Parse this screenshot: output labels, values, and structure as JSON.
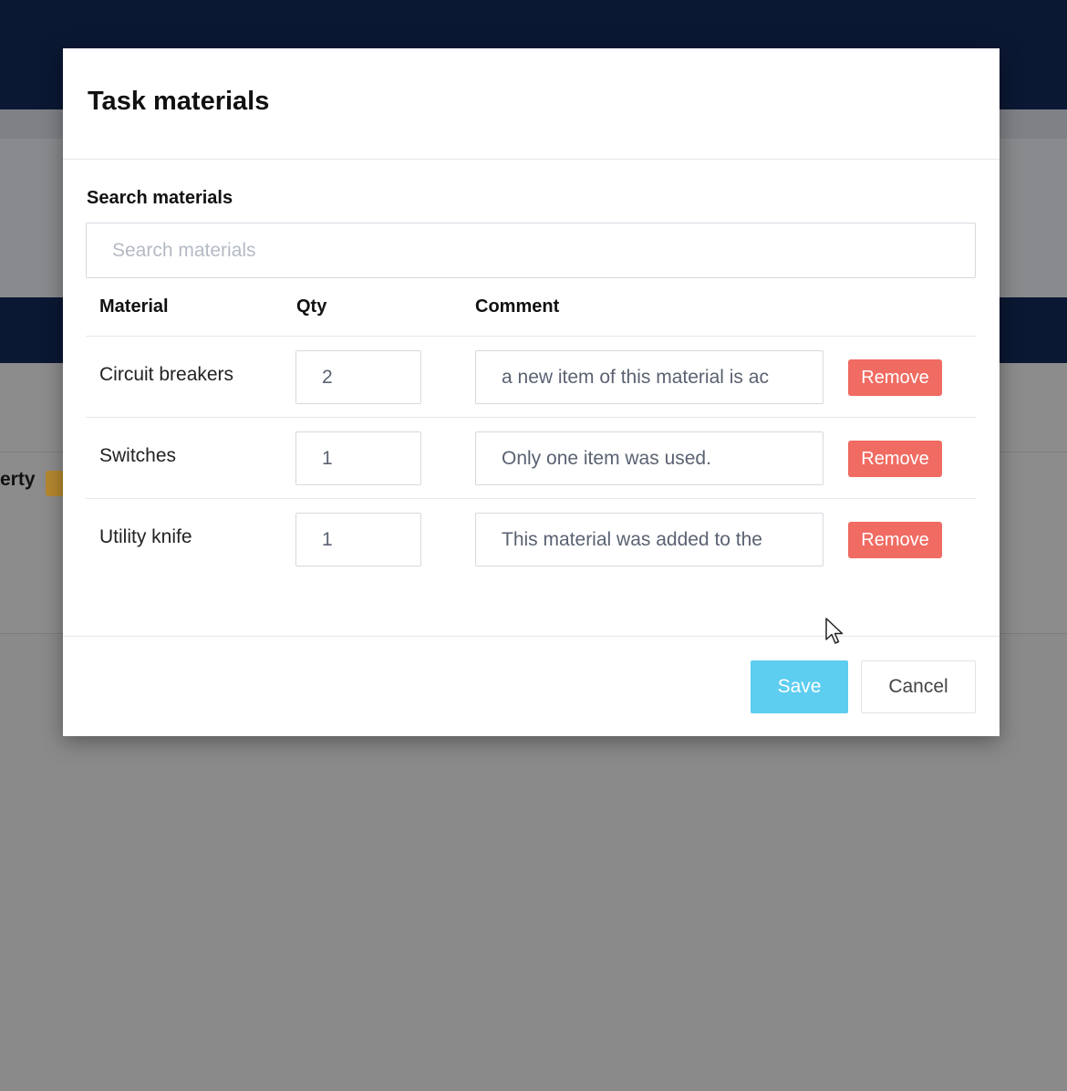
{
  "background": {
    "partial_text": "erty"
  },
  "modal": {
    "title": "Task materials",
    "search": {
      "label": "Search materials",
      "placeholder": "Search materials",
      "value": ""
    },
    "table": {
      "headers": [
        "Material",
        "Qty",
        "Comment"
      ],
      "rows": [
        {
          "material": "Circuit breakers",
          "qty": "2",
          "comment": "a new item of this material is ac"
        },
        {
          "material": "Switches",
          "qty": "1",
          "comment": "Only one item was used."
        },
        {
          "material": "Utility knife",
          "qty": "1",
          "comment": "This material was added to the"
        }
      ],
      "remove_label": "Remove"
    },
    "footer": {
      "save_label": "Save",
      "cancel_label": "Cancel"
    }
  },
  "colors": {
    "navbar": "#0b1833",
    "overlay": "#8a8a8a",
    "remove_button": "#f06b62",
    "save_button": "#5dcdf0",
    "badge": "#b5882f"
  }
}
